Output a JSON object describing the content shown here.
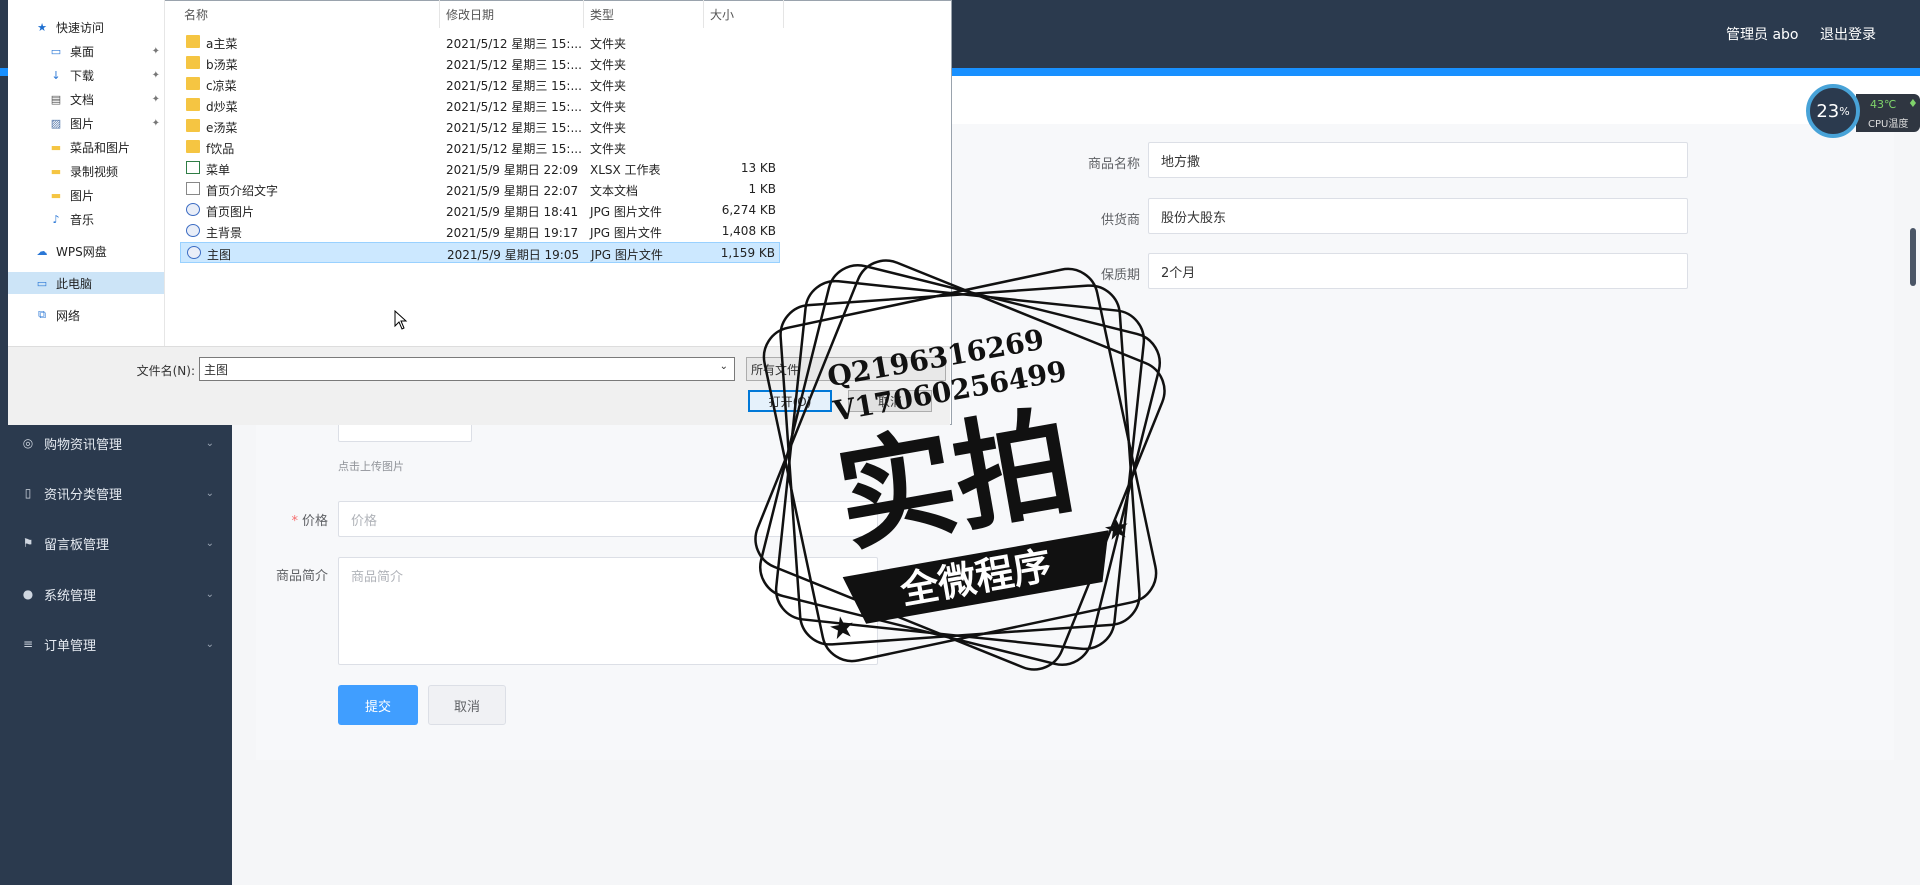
{
  "header": {
    "admin_label": "管理员 abo",
    "logout_label": "退出登录"
  },
  "sidebar": {
    "items": [
      {
        "label": "购物资讯管理",
        "icon": "compass-icon"
      },
      {
        "label": "资讯分类管理",
        "icon": "microphone-icon"
      },
      {
        "label": "留言板管理",
        "icon": "flag-icon"
      },
      {
        "label": "系统管理",
        "icon": "user-icon"
      },
      {
        "label": "订单管理",
        "icon": "list-icon"
      }
    ]
  },
  "form": {
    "name_label": "商品名称",
    "name_value": "地方撒",
    "supplier_label": "供货商",
    "supplier_value": "股份大股东",
    "shelf_label": "保质期",
    "shelf_value": "2个月",
    "upload_hint": "点击上传图片",
    "price_label": "价格",
    "price_placeholder": "价格",
    "intro_label": "商品简介",
    "intro_placeholder": "商品简介",
    "submit_label": "提交",
    "cancel_label": "取消"
  },
  "cpu": {
    "usage": "23",
    "usage_unit": "%",
    "temp": "43℃",
    "label": "CPU温度"
  },
  "dialog": {
    "nav": [
      {
        "label": "快速访问",
        "icon": "star-icon",
        "pinned": false
      },
      {
        "label": "桌面",
        "icon": "desktop-icon",
        "pinned": true
      },
      {
        "label": "下载",
        "icon": "download-icon",
        "pinned": true
      },
      {
        "label": "文档",
        "icon": "document-icon",
        "pinned": true
      },
      {
        "label": "图片",
        "icon": "picture-icon",
        "pinned": true
      },
      {
        "label": "菜品和图片",
        "icon": "folder-icon",
        "pinned": false
      },
      {
        "label": "录制视频",
        "icon": "folder-icon",
        "pinned": false
      },
      {
        "label": "图片",
        "icon": "folder-icon",
        "pinned": false
      },
      {
        "label": "音乐",
        "icon": "music-icon",
        "pinned": false
      },
      {
        "label": "WPS网盘",
        "icon": "cloud-icon",
        "pinned": false
      },
      {
        "label": "此电脑",
        "icon": "computer-icon",
        "pinned": false
      },
      {
        "label": "网络",
        "icon": "network-icon",
        "pinned": false
      }
    ],
    "columns": {
      "name": "名称",
      "modified": "修改日期",
      "type": "类型",
      "size": "大小"
    },
    "files": [
      {
        "name": "a主菜",
        "date": "2021/5/12 星期三 15:...",
        "type": "文件夹",
        "size": "",
        "kind": "folder"
      },
      {
        "name": "b汤菜",
        "date": "2021/5/12 星期三 15:...",
        "type": "文件夹",
        "size": "",
        "kind": "folder"
      },
      {
        "name": "c凉菜",
        "date": "2021/5/12 星期三 15:...",
        "type": "文件夹",
        "size": "",
        "kind": "folder"
      },
      {
        "name": "d炒菜",
        "date": "2021/5/12 星期三 15:...",
        "type": "文件夹",
        "size": "",
        "kind": "folder"
      },
      {
        "name": "e汤菜",
        "date": "2021/5/12 星期三 15:...",
        "type": "文件夹",
        "size": "",
        "kind": "folder"
      },
      {
        "name": "f饮品",
        "date": "2021/5/12 星期三 15:...",
        "type": "文件夹",
        "size": "",
        "kind": "folder"
      },
      {
        "name": "菜单",
        "date": "2021/5/9 星期日 22:09",
        "type": "XLSX 工作表",
        "size": "13 KB",
        "kind": "xlsx"
      },
      {
        "name": "首页介绍文字",
        "date": "2021/5/9 星期日 22:07",
        "type": "文本文档",
        "size": "1 KB",
        "kind": "txt"
      },
      {
        "name": "首页图片",
        "date": "2021/5/9 星期日 18:41",
        "type": "JPG 图片文件",
        "size": "6,274 KB",
        "kind": "jpg"
      },
      {
        "name": "主背景",
        "date": "2021/5/9 星期日 19:17",
        "type": "JPG 图片文件",
        "size": "1,408 KB",
        "kind": "jpg"
      },
      {
        "name": "主图",
        "date": "2021/5/9 星期日 19:05",
        "type": "JPG 图片文件",
        "size": "1,159 KB",
        "kind": "jpg"
      }
    ],
    "selected_index": 10,
    "filename_label": "文件名(N):",
    "filename_value": "主图",
    "filetype_value": "所有文件",
    "open_label": "打开(O)",
    "cancel_label": "取消"
  },
  "stamp": {
    "line1": "Q2196316269",
    "line2": "V17060256499",
    "big": "实拍",
    "banner": "全微程序"
  }
}
